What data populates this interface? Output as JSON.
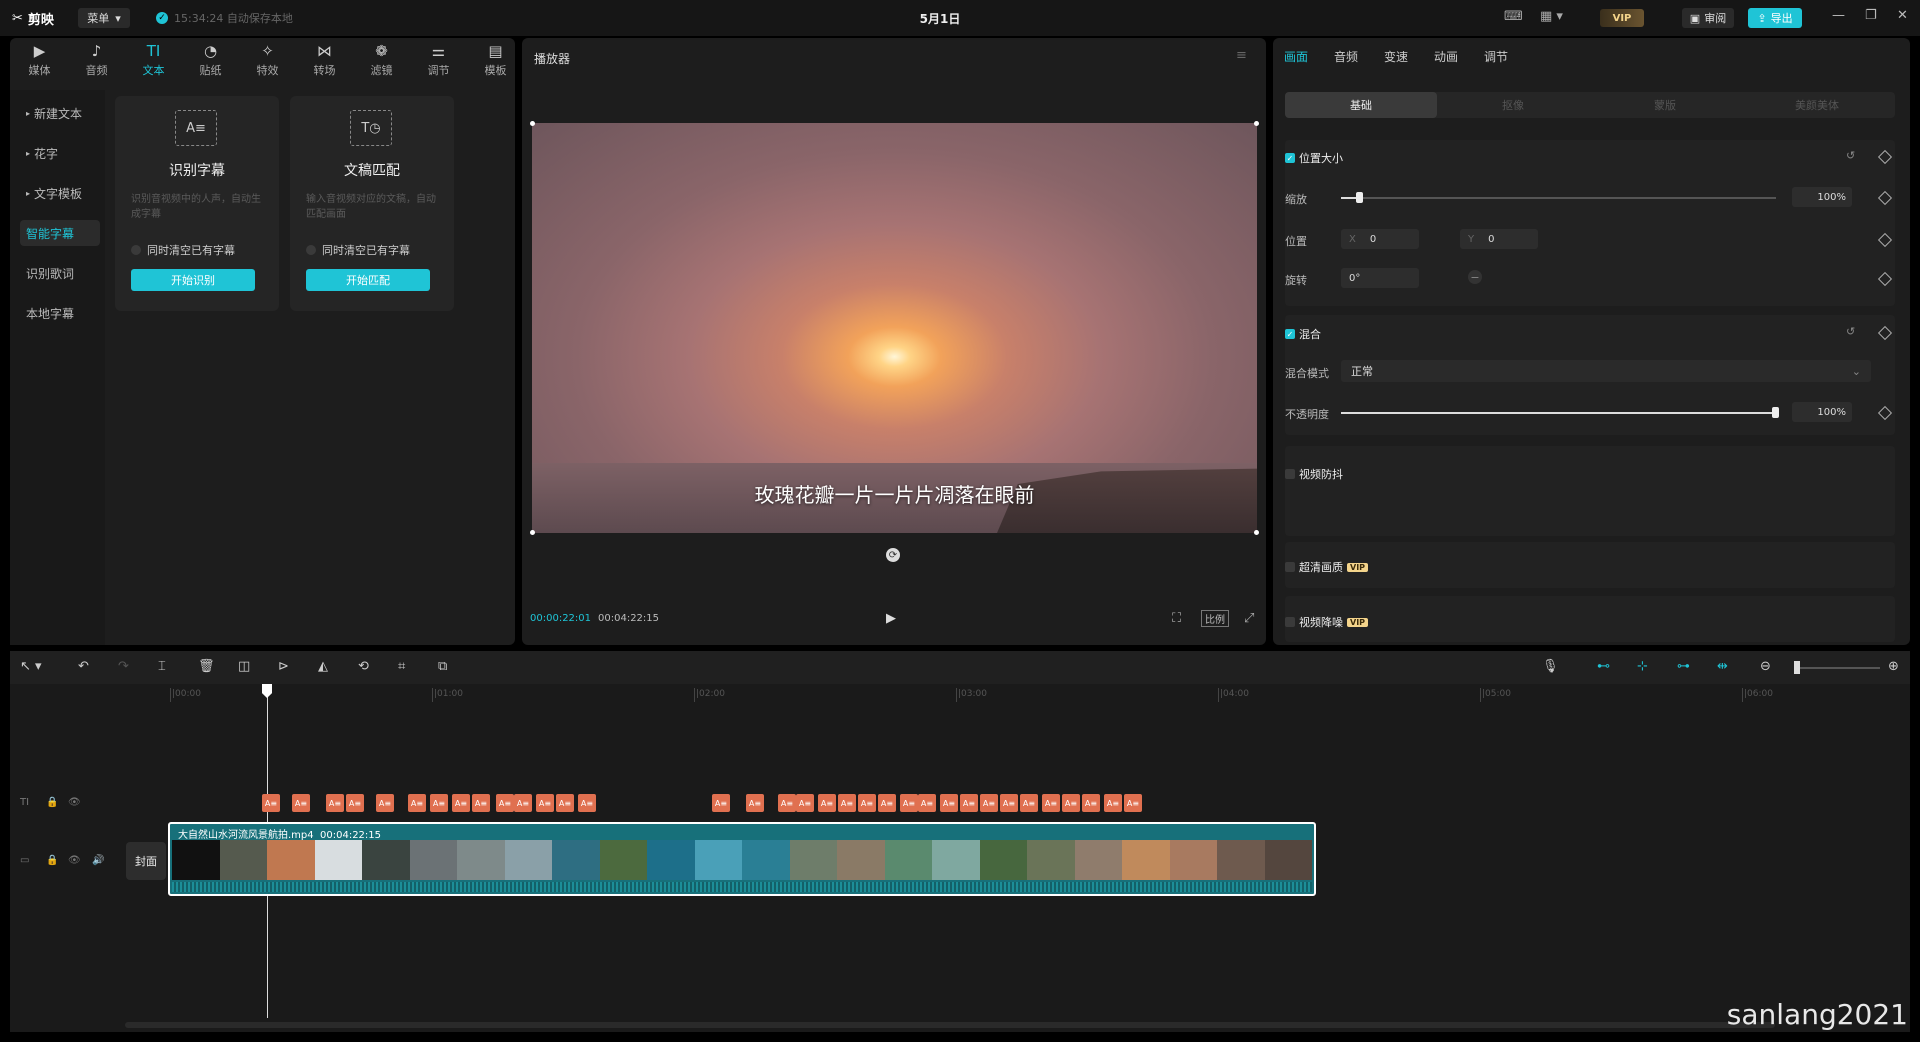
{
  "app": {
    "logo_text": "剪映",
    "menu_label": "菜单",
    "autosave_text": "15:34:24 自动保存本地",
    "project_title": "5月1日",
    "vip_label": "VIP",
    "review_label": "审阅",
    "export_label": "导出"
  },
  "tool_tabs": [
    {
      "label": "媒体",
      "icon": "media-icon"
    },
    {
      "label": "音频",
      "icon": "audio-icon"
    },
    {
      "label": "文本",
      "icon": "text-icon",
      "active": true
    },
    {
      "label": "贴纸",
      "icon": "sticker-icon"
    },
    {
      "label": "特效",
      "icon": "effects-icon"
    },
    {
      "label": "转场",
      "icon": "transition-icon"
    },
    {
      "label": "滤镜",
      "icon": "filter-icon"
    },
    {
      "label": "调节",
      "icon": "adjust-icon"
    },
    {
      "label": "模板",
      "icon": "template-icon"
    }
  ],
  "text_subnav": [
    {
      "label": "新建文本"
    },
    {
      "label": "花字"
    },
    {
      "label": "文字模板"
    },
    {
      "label": "智能字幕",
      "active": true
    },
    {
      "label": "识别歌词"
    },
    {
      "label": "本地字幕"
    }
  ],
  "cards": [
    {
      "title": "识别字幕",
      "desc": "识别音视频中的人声，自动生成字幕",
      "check": "同时清空已有字幕",
      "button": "开始识别",
      "icon_text": "A≡"
    },
    {
      "title": "文稿匹配",
      "desc": "输入音视频对应的文稿，自动匹配画面",
      "check": "同时清空已有字幕",
      "button": "开始匹配",
      "icon_text": "T◷"
    }
  ],
  "player": {
    "title": "播放器",
    "subtitle": "玫瑰花瓣一片一片片凋落在眼前",
    "current_time": "00:00:22:01",
    "total_time": "00:04:22:15",
    "ratio_label": "比例"
  },
  "inspector": {
    "tabs": [
      "画面",
      "音频",
      "变速",
      "动画",
      "调节"
    ],
    "active_tab": "画面",
    "subtabs": [
      "基础",
      "抠像",
      "蒙版",
      "美颜美体"
    ],
    "active_subtab": "基础",
    "position_size": {
      "label": "位置大小",
      "scale_label": "缩放",
      "scale_value": "100%",
      "scale_percent": 100,
      "position_label": "位置",
      "x_axis": "X",
      "x_value": "0",
      "y_axis": "Y",
      "y_value": "0",
      "rotate_label": "旋转",
      "rotate_value": "0°"
    },
    "blend": {
      "label": "混合",
      "mode_label": "混合模式",
      "mode_value": "正常",
      "opacity_label": "不透明度",
      "opacity_value": "100%",
      "opacity_percent": 100
    },
    "stabilize_label": "视频防抖",
    "hd_label": "超清画质",
    "denoise_label": "视频降噪",
    "vip_tag": "VIP"
  },
  "timeline": {
    "ruler": [
      "|00:00",
      "|01:00",
      "|02:00",
      "|03:00",
      "|04:00",
      "|05:00",
      "|06:00"
    ],
    "cover_label": "封面",
    "clip_name": "大自然山水河流风景航拍.mp4",
    "clip_duration": "00:04:22:15",
    "subtitle_clip_label": "A≡"
  },
  "watermark": "sanlang2021",
  "colors": {
    "accent": "#1fc4d6",
    "subtitle_clip": "#e07050",
    "video_clip": "#17707a"
  }
}
